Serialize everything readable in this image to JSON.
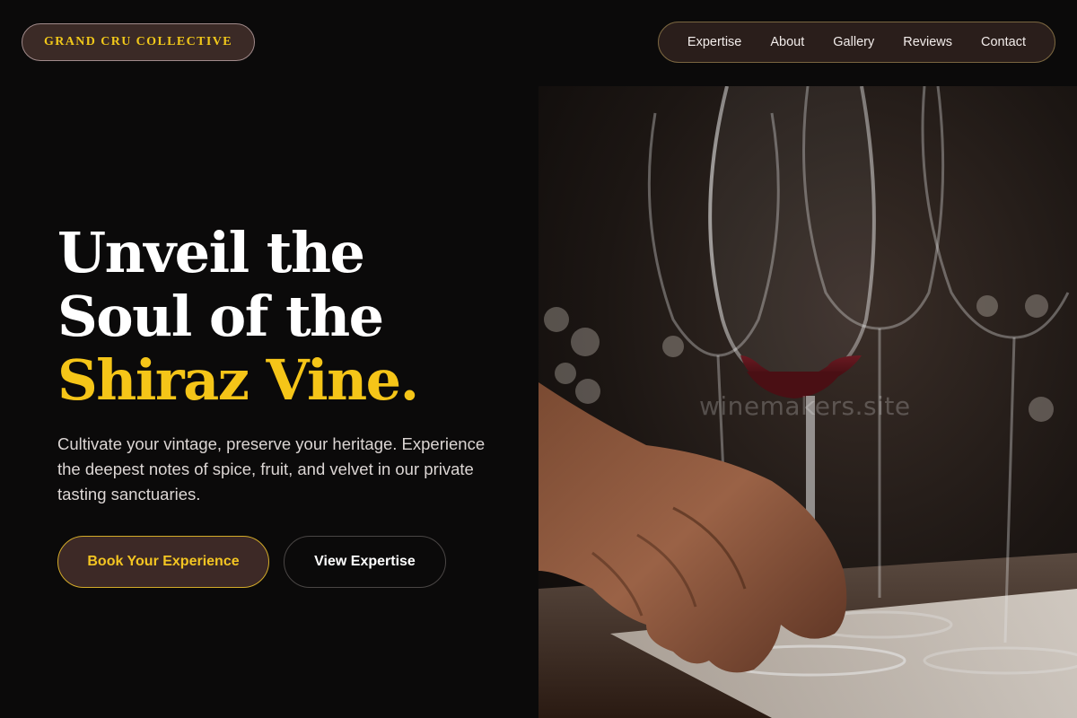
{
  "brand": {
    "name": "GRAND CRU COLLECTIVE"
  },
  "nav": {
    "items": [
      {
        "label": "Expertise"
      },
      {
        "label": "About"
      },
      {
        "label": "Gallery"
      },
      {
        "label": "Reviews"
      },
      {
        "label": "Contact"
      }
    ]
  },
  "hero": {
    "headline_line1": "Unveil the",
    "headline_line2": "Soul of the",
    "headline_accent": "Shiraz Vine.",
    "subcopy": "Cultivate your vintage, preserve your heritage. Experience the deepest notes of spice, fruit, and velvet in our private tasting sanctuaries.",
    "primary_cta": "Book Your Experience",
    "secondary_cta": "View Expertise",
    "image_watermark": "winemakers.site"
  },
  "colors": {
    "background": "#0b0a0a",
    "accent_gold": "#f5c518",
    "pill_brown": "#3b2a26"
  }
}
